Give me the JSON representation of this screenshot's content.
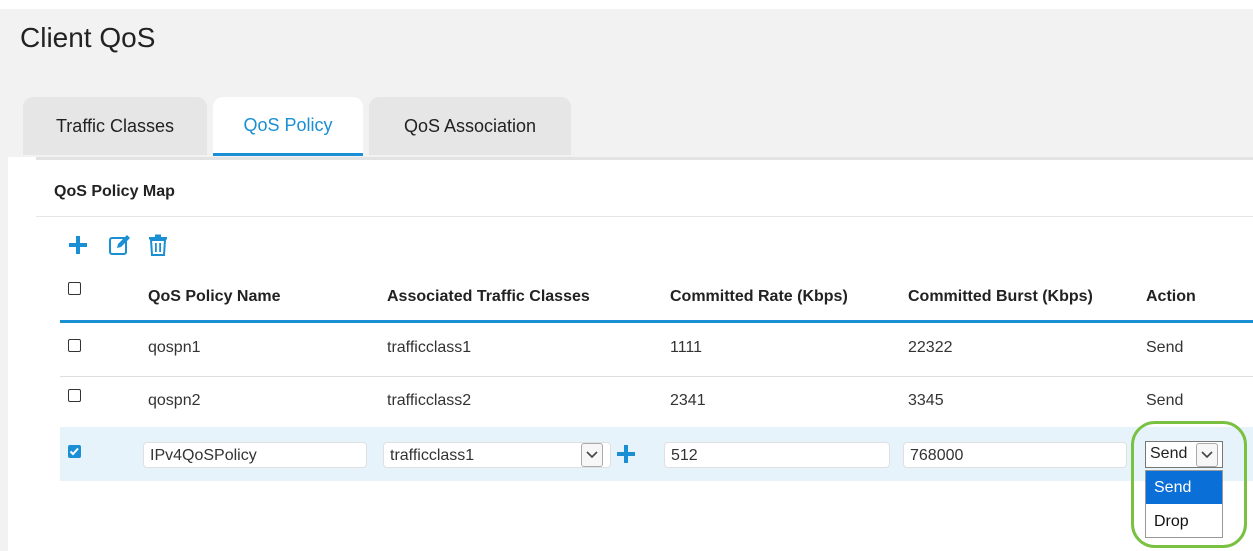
{
  "page": {
    "title": "Client QoS"
  },
  "tabs": [
    {
      "label": "Traffic Classes",
      "active": false
    },
    {
      "label": "QoS Policy",
      "active": true
    },
    {
      "label": "QoS Association",
      "active": false
    }
  ],
  "section": {
    "title": "QoS Policy Map"
  },
  "toolbar": {
    "icons": [
      "add-icon",
      "edit-icon",
      "delete-icon"
    ]
  },
  "table": {
    "columns": [
      "QoS Policy Name",
      "Associated Traffic Classes",
      "Committed Rate (Kbps)",
      "Committed Burst (Kbps)",
      "Action"
    ],
    "rows": [
      {
        "checked": false,
        "name": "qospn1",
        "classes": "trafficclass1",
        "rate": "1111",
        "burst": "22322",
        "action": "Send"
      },
      {
        "checked": false,
        "name": "qospn2",
        "classes": "trafficclass2",
        "rate": "2341",
        "burst": "3345",
        "action": "Send"
      }
    ],
    "edit_row": {
      "checked": true,
      "name": "IPv4QoSPolicy",
      "classes": "trafficclass1",
      "rate": "512",
      "burst": "768000",
      "action": "Send",
      "action_options": [
        "Send",
        "Drop"
      ]
    }
  },
  "colors": {
    "accent": "#1a8fd4",
    "highlight": "#7ac142",
    "selected_option": "#0a6fd6"
  }
}
